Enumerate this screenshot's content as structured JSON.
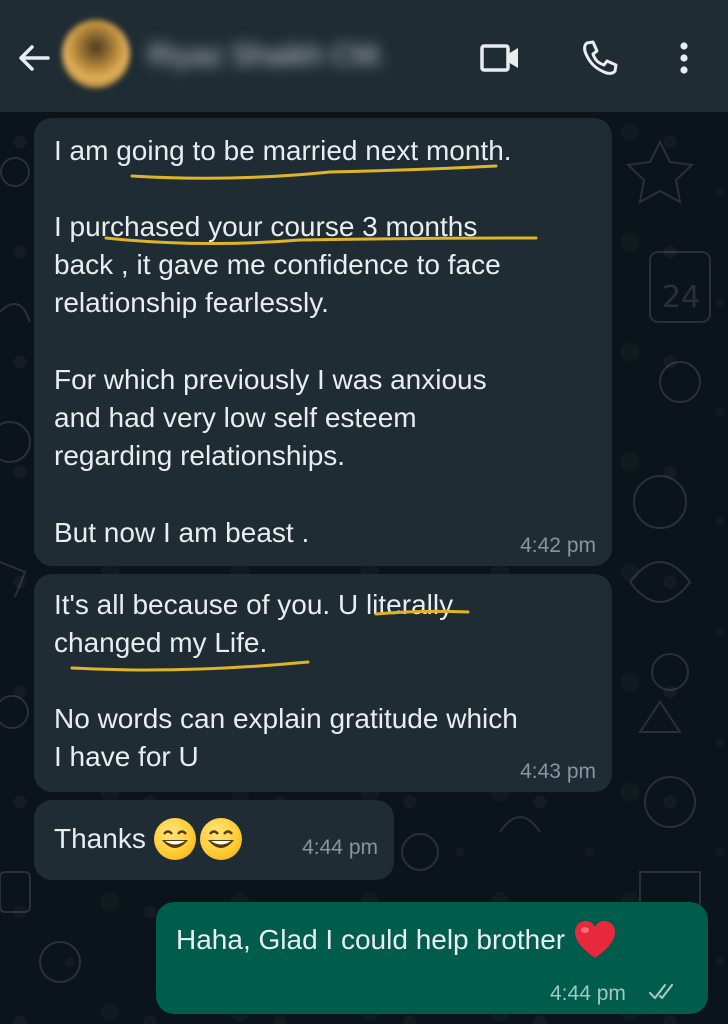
{
  "header": {
    "contact_name": "Riyaz Shaikh CM.",
    "icons": {
      "back": "arrow-left-icon",
      "video": "video-camera-icon",
      "call": "phone-icon",
      "menu": "more-vert-icon"
    }
  },
  "messages": [
    {
      "direction": "incoming",
      "lines": [
        "I am going to be married next month.",
        "",
        "I purchased your course 3 months",
        "back , it gave me confidence to face",
        "relationship fearlessly.",
        "",
        "For which previously I was anxious",
        "and had very low self esteem",
        "regarding relationships.",
        "",
        "But now I am beast ."
      ],
      "time": "4:42 pm"
    },
    {
      "direction": "incoming",
      "lines": [
        "It's all because of you. U literally",
        "changed my Life.",
        "",
        "No words can explain gratitude which",
        "I have for U"
      ],
      "time": "4:43 pm"
    },
    {
      "direction": "incoming",
      "text": "Thanks",
      "emoji": [
        "grinning-face-emoji",
        "grinning-face-emoji"
      ],
      "time": "4:44 pm"
    },
    {
      "direction": "outgoing",
      "text": "Haha, Glad I could help brother",
      "emoji": [
        "red-heart-emoji"
      ],
      "time": "4:44 pm",
      "status": "read-double-check-icon"
    }
  ],
  "colors": {
    "header_bg": "#1f2c34",
    "chat_bg": "#0b141a",
    "incoming_bubble": "#1f2c34",
    "outgoing_bubble": "#005c4b",
    "highlight_underline": "#e0b429",
    "read_ticks": "#9fc9bd"
  }
}
